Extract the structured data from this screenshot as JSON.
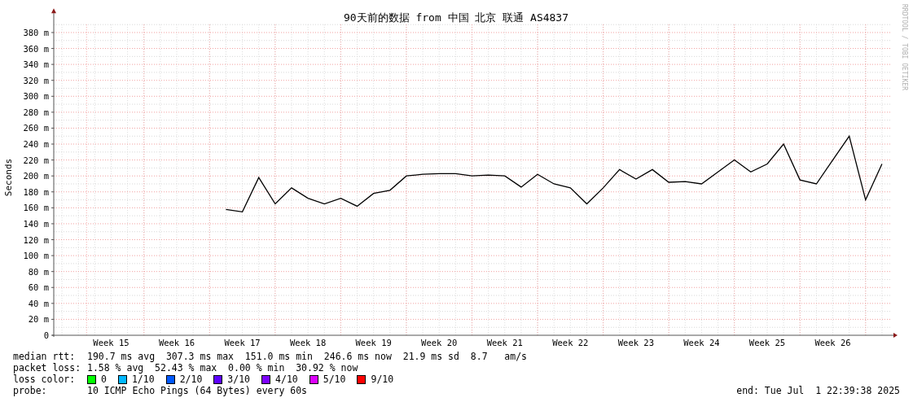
{
  "chart_data": {
    "type": "line",
    "grid": true,
    "title": "90天前的数据 from 中国 北京 联通 AS4837",
    "ylabel": "Seconds",
    "ylim": [
      0,
      390
    ],
    "categories": [
      null,
      null,
      null,
      "Week 15",
      null,
      null,
      null,
      "Week 16",
      null,
      null,
      null,
      "Week 17",
      null,
      null,
      null,
      "Week 18",
      null,
      null,
      null,
      "Week 19",
      null,
      null,
      null,
      "Week 20",
      null,
      null,
      null,
      "Week 21",
      null,
      null,
      null,
      "Week 22",
      null,
      null,
      null,
      "Week 23",
      null,
      null,
      null,
      "Week 24",
      null,
      null,
      null,
      "Week 25",
      null,
      null,
      null,
      "Week 26",
      null,
      null,
      null
    ],
    "yticks": [
      {
        "value": 0,
        "label": "0"
      },
      {
        "value": 20,
        "label": "20 m"
      },
      {
        "value": 40,
        "label": "40 m"
      },
      {
        "value": 60,
        "label": "60 m"
      },
      {
        "value": 80,
        "label": "80 m"
      },
      {
        "value": 100,
        "label": "100 m"
      },
      {
        "value": 120,
        "label": "120 m"
      },
      {
        "value": 140,
        "label": "140 m"
      },
      {
        "value": 160,
        "label": "160 m"
      },
      {
        "value": 180,
        "label": "180 m"
      },
      {
        "value": 200,
        "label": "200 m"
      },
      {
        "value": 220,
        "label": "220 m"
      },
      {
        "value": 240,
        "label": "240 m"
      },
      {
        "value": 260,
        "label": "260 m"
      },
      {
        "value": 280,
        "label": "280 m"
      },
      {
        "value": 300,
        "label": "300 m"
      },
      {
        "value": 320,
        "label": "320 m"
      },
      {
        "value": 340,
        "label": "340 m"
      },
      {
        "value": 360,
        "label": "360 m"
      },
      {
        "value": 380,
        "label": "380 m"
      }
    ],
    "series": [
      {
        "color": "#000000",
        "values": [
          null,
          null,
          null,
          null,
          null,
          null,
          null,
          null,
          null,
          null,
          158,
          155,
          198,
          165,
          185,
          172,
          165,
          172,
          162,
          178,
          182,
          200,
          202,
          203,
          203,
          200,
          201,
          200,
          186,
          202,
          190,
          185,
          165,
          185,
          208,
          196,
          208,
          192,
          193,
          190,
          205,
          220,
          205,
          215,
          240,
          195,
          190,
          220,
          250,
          170,
          215
        ]
      }
    ]
  },
  "credit": "RRDTOOL / TOBI OETIKER",
  "stats": [
    {
      "label": "median rtt:",
      "text": "190.7 ms avg  307.3 ms max  151.0 ms min  246.6 ms now  21.9 ms sd  8.7   am/s"
    },
    {
      "label": "packet loss:",
      "text": "1.58 % avg  52.43 % max  0.00 % min  30.92 % now"
    }
  ],
  "loss_color": {
    "label": "loss color:",
    "items": [
      {
        "label": "0",
        "color": "#00ff00"
      },
      {
        "label": "1/10",
        "color": "#00b8ff"
      },
      {
        "label": "2/10",
        "color": "#0059ff"
      },
      {
        "label": "3/10",
        "color": "#5e00ff"
      },
      {
        "label": "4/10",
        "color": "#7e00ff"
      },
      {
        "label": "5/10",
        "color": "#dd00ff"
      },
      {
        "label": "9/10",
        "color": "#ff0000"
      }
    ]
  },
  "probe": {
    "label": "probe:",
    "text": "10 ICMP Echo Pings (64 Bytes) every 60s"
  },
  "end": "end: Tue Jul  1 22:39:38 2025"
}
